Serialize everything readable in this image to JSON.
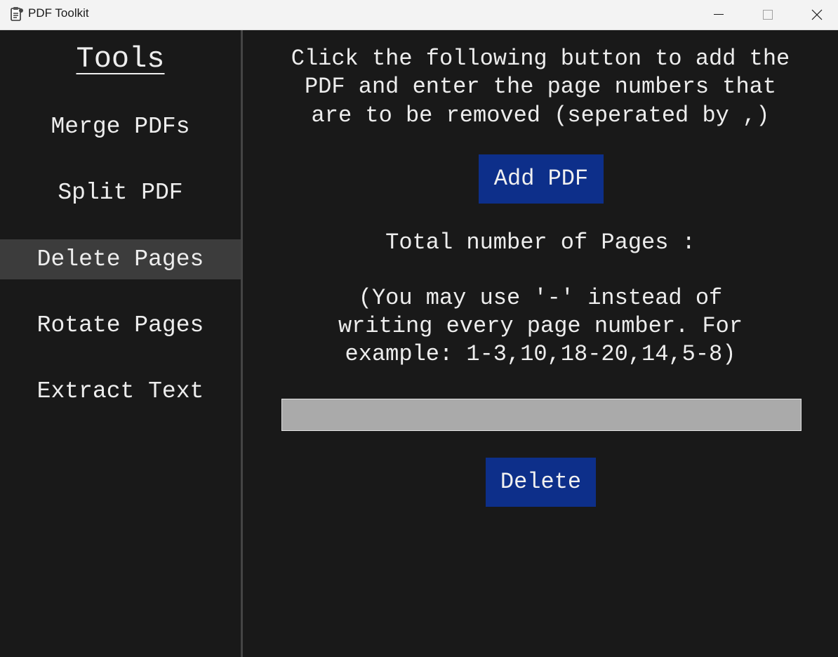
{
  "window": {
    "title": "PDF Toolkit",
    "icon": "clipboard-pdf-icon",
    "controls": [
      "minimize-icon",
      "maximize-icon",
      "close-icon"
    ]
  },
  "sidebar": {
    "title": "Tools",
    "items": [
      {
        "label": "Merge PDFs",
        "active": false
      },
      {
        "label": "Split PDF",
        "active": false
      },
      {
        "label": "Delete Pages",
        "active": true
      },
      {
        "label": "Rotate Pages",
        "active": false
      },
      {
        "label": "Extract Text",
        "active": false
      }
    ]
  },
  "main": {
    "instructions": [
      "Click the following button to add the",
      "PDF and enter the page numbers that",
      "are to be removed (seperated by ,)"
    ],
    "add_pdf_label": "Add PDF",
    "total_pages_label": "Total number of Pages :",
    "hint": [
      "(You may use '-' instead of",
      "writing every page number. For",
      "example: 1-3,10,18-20,14,5-8)"
    ],
    "pages_input_value": "",
    "delete_label": "Delete"
  },
  "colors": {
    "background": "#191919",
    "active_item": "#3c3c3c",
    "button": "#0d2f8a",
    "input": "#aaaaaa",
    "text": "#ededed"
  }
}
